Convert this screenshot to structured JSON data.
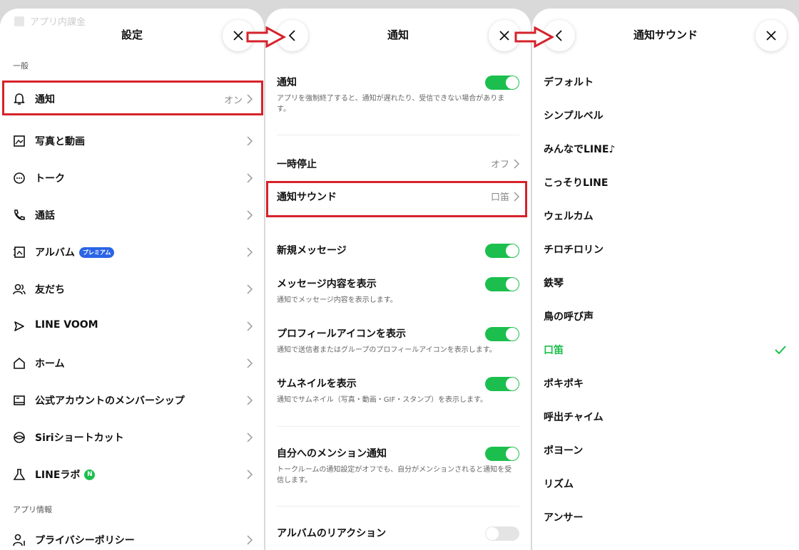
{
  "panel1": {
    "ghost_label": "アプリ内課金",
    "title": "設定",
    "section_general": "一般",
    "items": [
      {
        "label": "通知",
        "value": "オン"
      },
      {
        "label": "写真と動画",
        "value": ""
      },
      {
        "label": "トーク",
        "value": ""
      },
      {
        "label": "通話",
        "value": ""
      },
      {
        "label": "アルバム",
        "value": "",
        "badge": "プレミアム"
      },
      {
        "label": "友だち",
        "value": ""
      },
      {
        "label": "LINE VOOM",
        "value": ""
      },
      {
        "label": "ホーム",
        "value": ""
      },
      {
        "label": "公式アカウントのメンバーシップ",
        "value": ""
      },
      {
        "label": "Siriショートカット",
        "value": ""
      },
      {
        "label": "LINEラボ",
        "value": "",
        "badge": "N"
      }
    ],
    "section_app_info": "アプリ情報",
    "app_info_items": [
      {
        "label": "プライバシーポリシー"
      }
    ]
  },
  "panel2": {
    "title": "通知",
    "notify": {
      "label": "通知",
      "desc": "アプリを強制終了すると、通知が遅れたり、受信できない場合があります。",
      "on": true
    },
    "pause": {
      "label": "一時停止",
      "value": "オフ"
    },
    "sound": {
      "label": "通知サウンド",
      "value": "口笛"
    },
    "toggles": [
      {
        "label": "新規メッセージ",
        "desc": "",
        "on": true
      },
      {
        "label": "メッセージ内容を表示",
        "desc": "通知でメッセージ内容を表示します。",
        "on": true
      },
      {
        "label": "プロフィールアイコンを表示",
        "desc": "通知で送信者またはグループのプロフィールアイコンを表示します。",
        "on": true
      },
      {
        "label": "サムネイルを表示",
        "desc": "通知でサムネイル（写真・動画・GIF・スタンプ）を表示します。",
        "on": true
      },
      {
        "label": "自分へのメンション通知",
        "desc": "トークルームの通知設定がオフでも、自分がメンションされると通知を受信します。",
        "on": true
      },
      {
        "label": "アルバムのリアクション",
        "desc": "",
        "on": false
      }
    ]
  },
  "panel3": {
    "title": "通知サウンド",
    "sounds": [
      "デフォルト",
      "シンプルベル",
      "みんなでLINE♪",
      "こっそりLINE",
      "ウェルカム",
      "チロチロリン",
      "鉄琴",
      "鳥の呼び声",
      "口笛",
      "ポキポキ",
      "呼出チャイム",
      "ポヨーン",
      "リズム",
      "アンサー"
    ],
    "selected": "口笛"
  },
  "colors": {
    "accent": "#1cbf4d",
    "highlight": "#d6222b",
    "premium": "#2a64e6"
  }
}
